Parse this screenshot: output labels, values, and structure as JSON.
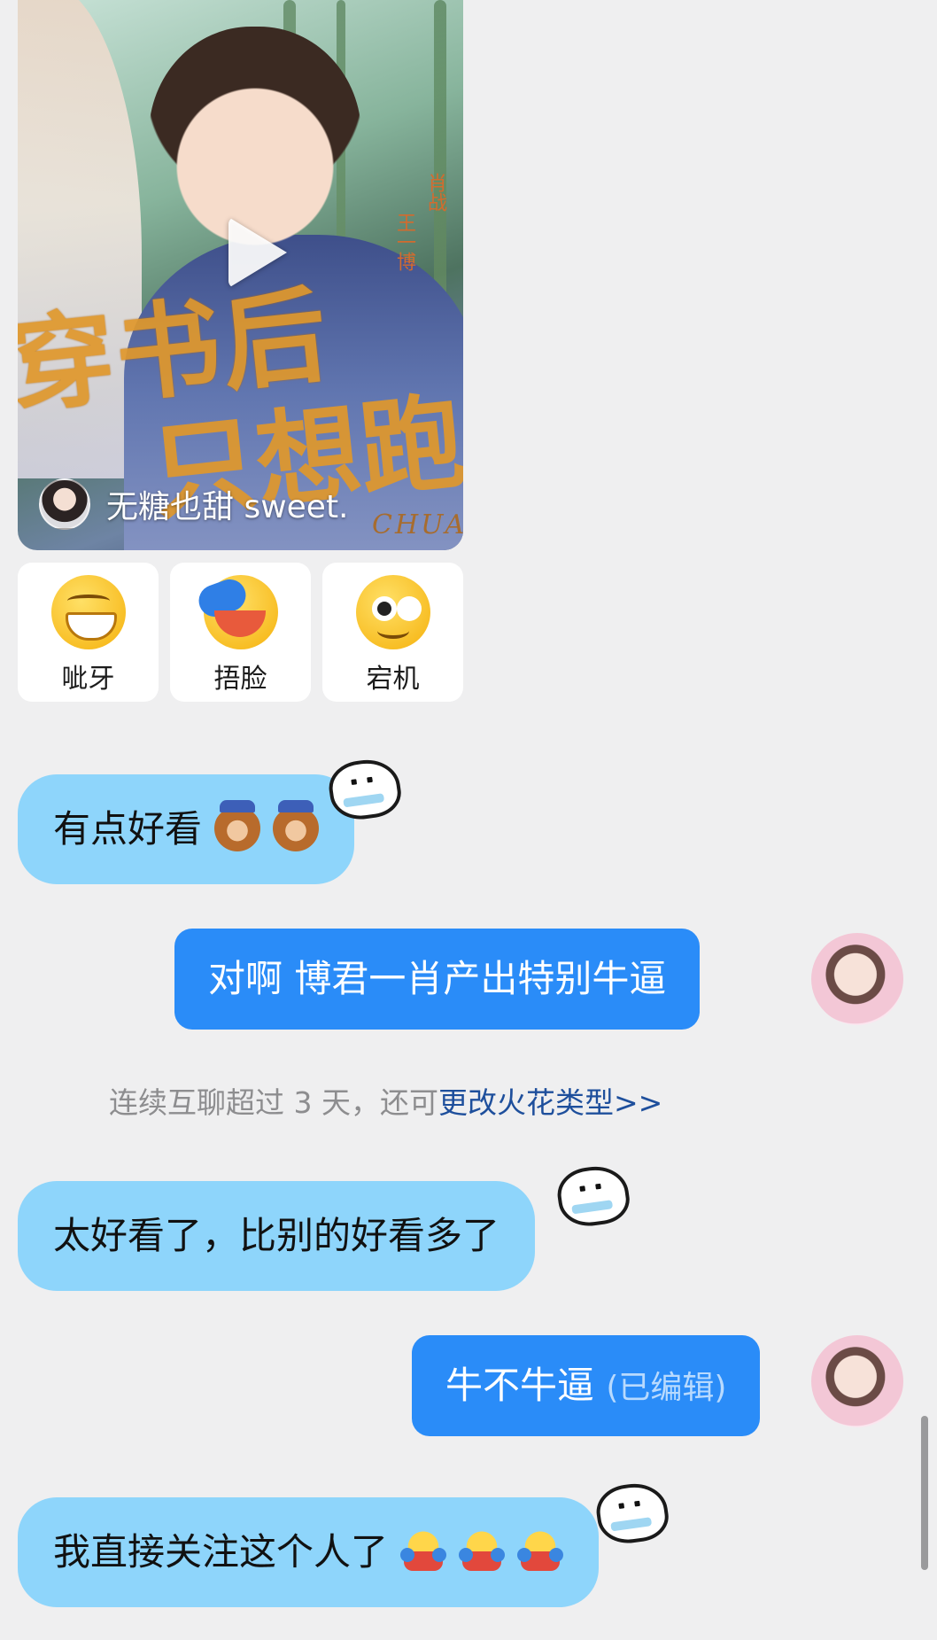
{
  "video": {
    "author_name": "无糖也甜 sweet.",
    "title_art_line1": "穿书后",
    "title_art_line2": "只想跑",
    "side_text_1": "肖战",
    "side_text_2": "王一博",
    "watermark": "CHUAN"
  },
  "reactions": [
    {
      "label": "呲牙",
      "icon": "grin-emoji"
    },
    {
      "label": "捂脸",
      "icon": "facepalm-emoji"
    },
    {
      "label": "宕机",
      "icon": "dizzy-emoji"
    }
  ],
  "messages": [
    {
      "side": "in",
      "text": "有点好看",
      "trailing_emojis": [
        "chipmunk-sticker",
        "chipmunk-sticker"
      ]
    },
    {
      "side": "out",
      "text": "对啊 博君一肖产出特别牛逼"
    },
    {
      "side": "system",
      "text": "连续互聊超过 3 天，还可",
      "link": "更改火花类型>>"
    },
    {
      "side": "in",
      "text": "太好看了，比别的好看多了"
    },
    {
      "side": "out",
      "text": "牛不牛逼",
      "edited_label": "(已编辑)"
    },
    {
      "side": "in",
      "text": "我直接关注这个人了",
      "trailing_emojis": [
        "hug-emoji",
        "hug-emoji",
        "hug-emoji"
      ]
    }
  ],
  "colors": {
    "background": "#efeff0",
    "incoming_bubble": "#8ed5fb",
    "outgoing_bubble": "#2a8cf8",
    "link": "#1e4f9c"
  }
}
